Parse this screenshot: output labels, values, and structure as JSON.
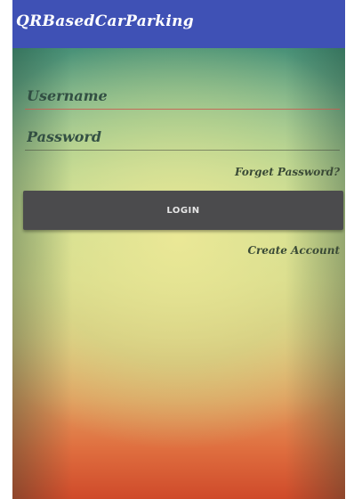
{
  "app_bar": {
    "title": "QRBasedCarParking",
    "color": "#3f51b5"
  },
  "login_form": {
    "username_placeholder": "Username",
    "password_placeholder": "Password",
    "forgot_password_label": "Forget Password?",
    "login_label": "LOGIN",
    "create_account_label": "Create Account"
  },
  "colors": {
    "login_button_bg": "#4b4b4d",
    "username_underline": "#c85a50"
  }
}
